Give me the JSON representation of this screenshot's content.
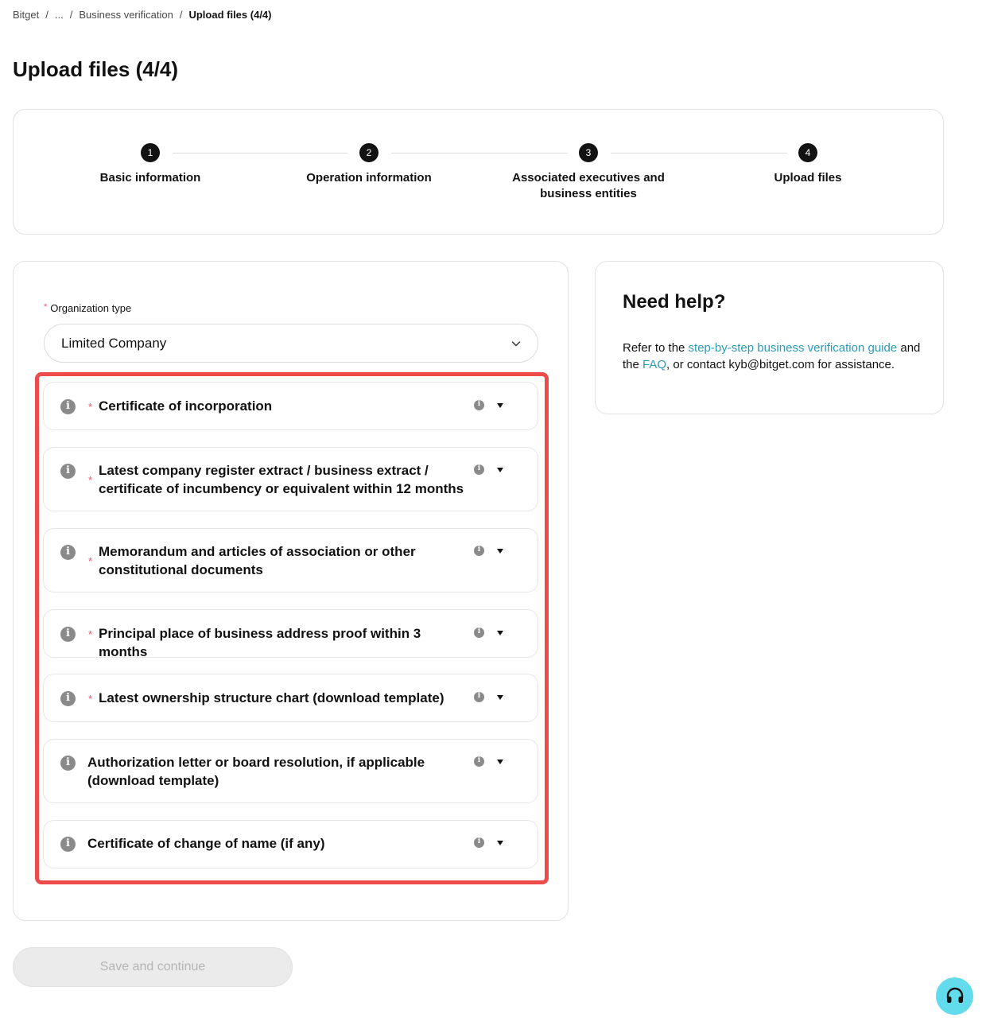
{
  "breadcrumb": {
    "items": [
      "Bitget",
      "...",
      "Business verification"
    ],
    "separator": "/",
    "current": "Upload files (4/4)"
  },
  "page_title": "Upload files (4/4)",
  "steps": [
    {
      "number": "1",
      "label": "Basic information"
    },
    {
      "number": "2",
      "label": "Operation information"
    },
    {
      "number": "3",
      "label": "Associated executives and business entities"
    },
    {
      "number": "4",
      "label": "Upload files"
    }
  ],
  "form": {
    "org_type_label": "Organization type",
    "required_mark": "*",
    "org_type_value": "Limited Company",
    "documents": [
      {
        "title": "Certificate of incorporation",
        "required": true
      },
      {
        "title": "Latest company register extract / business extract / certificate of incumbency or equivalent within 12 months",
        "required": true
      },
      {
        "title": "Memorandum and articles of association or other constitutional documents",
        "required": true
      },
      {
        "title": "Principal place of business address proof within 3 months",
        "required": true
      },
      {
        "title": "Latest ownership structure chart (download template)",
        "required": true
      },
      {
        "title": "Authorization letter or board resolution, if applicable (download template)",
        "required": false
      },
      {
        "title": "Certificate of change of name (if any)",
        "required": false
      }
    ]
  },
  "help": {
    "title": "Need help?",
    "text_before_guide": "Refer to the ",
    "guide_link": "step-by-step business verification guide",
    "text_before_faq": " and the ",
    "faq_link": "FAQ",
    "text_after": ", or contact kyb@bitget.com for assistance."
  },
  "save_button": "Save and continue",
  "colors": {
    "accent_link": "#2d9ab7",
    "highlight_border": "#ee4b4b",
    "required_star": "#f0506e",
    "support_button": "#62dced"
  },
  "icons": {
    "info": "info-icon",
    "caret": "caret-down-icon",
    "chevron": "chevron-down-icon",
    "support": "headset-icon"
  }
}
